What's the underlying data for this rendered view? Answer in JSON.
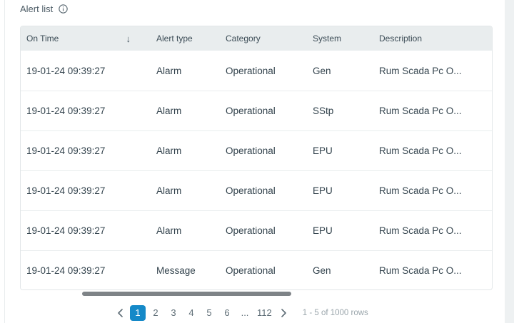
{
  "header": {
    "title": "Alert list"
  },
  "table": {
    "columns": [
      {
        "label": "On Time",
        "sort": "desc",
        "sort_glyph": "↓"
      },
      {
        "label": "Alert type"
      },
      {
        "label": "Category"
      },
      {
        "label": "System"
      },
      {
        "label": "Description"
      }
    ],
    "rows": [
      {
        "on_time": "19-01-24 09:39:27",
        "alert_type": "Alarm",
        "category": "Operational",
        "system": "Gen",
        "description": "Rum Scada Pc O..."
      },
      {
        "on_time": "19-01-24 09:39:27",
        "alert_type": "Alarm",
        "category": "Operational",
        "system": "SStp",
        "description": "Rum Scada Pc O..."
      },
      {
        "on_time": "19-01-24 09:39:27",
        "alert_type": "Alarm",
        "category": "Operational",
        "system": "EPU",
        "description": "Rum Scada Pc O..."
      },
      {
        "on_time": "19-01-24 09:39:27",
        "alert_type": "Alarm",
        "category": "Operational",
        "system": "EPU",
        "description": "Rum Scada Pc O..."
      },
      {
        "on_time": "19-01-24 09:39:27",
        "alert_type": "Alarm",
        "category": "Operational",
        "system": "EPU",
        "description": "Rum Scada Pc O..."
      },
      {
        "on_time": "19-01-24 09:39:27",
        "alert_type": "Message",
        "category": "Operational",
        "system": "Gen",
        "description": "Rum Scada Pc O..."
      }
    ]
  },
  "pagination": {
    "pages": [
      "1",
      "2",
      "3",
      "4",
      "5",
      "6",
      "...",
      "112"
    ],
    "active_page": "1",
    "range_text": "1 - 5 of 1000 rows"
  },
  "colors": {
    "accent_blue": "#1589c8",
    "header_bg": "#e9edee",
    "text_dark": "#33434d",
    "muted_gray": "#9aa5ab"
  }
}
